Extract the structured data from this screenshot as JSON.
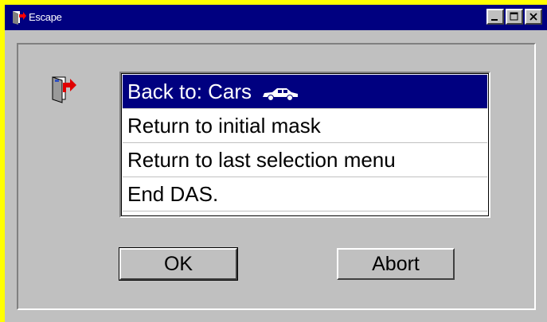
{
  "window": {
    "title": "Escape",
    "icon": "door-exit-icon",
    "controls": [
      "minimize-icon",
      "maximize-icon",
      "close-icon"
    ]
  },
  "dialog": {
    "icon": "door-exit-icon",
    "options": [
      {
        "label": "Back to: Cars",
        "selected": true,
        "icon": "car-icon"
      },
      {
        "label": "Return to initial mask",
        "selected": false
      },
      {
        "label": "Return to last selection menu",
        "selected": false
      },
      {
        "label": "End DAS.",
        "selected": false
      }
    ]
  },
  "buttons": {
    "ok_label": "OK",
    "abort_label": "Abort"
  },
  "colors": {
    "titlebar": "#000080",
    "selection": "#000080",
    "face": "#c0c0c0",
    "frame": "#ffff00"
  }
}
